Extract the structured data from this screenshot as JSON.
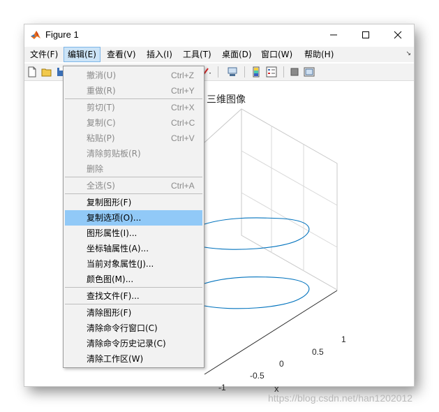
{
  "window": {
    "title": "Figure 1"
  },
  "menubar": {
    "items": [
      {
        "label": "文件(F)"
      },
      {
        "label": "编辑(E)"
      },
      {
        "label": "查看(V)"
      },
      {
        "label": "插入(I)"
      },
      {
        "label": "工具(T)"
      },
      {
        "label": "桌面(D)"
      },
      {
        "label": "窗口(W)"
      },
      {
        "label": "帮助(H)"
      }
    ]
  },
  "edit_menu": {
    "items": [
      {
        "label": "撤消(U)",
        "shortcut": "Ctrl+Z",
        "enabled": false
      },
      {
        "label": "重做(R)",
        "shortcut": "Ctrl+Y",
        "enabled": false
      },
      {
        "label": "剪切(T)",
        "shortcut": "Ctrl+X",
        "enabled": false
      },
      {
        "label": "复制(C)",
        "shortcut": "Ctrl+C",
        "enabled": false
      },
      {
        "label": "粘贴(P)",
        "shortcut": "Ctrl+V",
        "enabled": false
      },
      {
        "label": "清除剪贴板(R)",
        "shortcut": "",
        "enabled": false
      },
      {
        "label": "删除",
        "shortcut": "",
        "enabled": false
      },
      {
        "label": "全选(S)",
        "shortcut": "Ctrl+A",
        "enabled": false
      },
      {
        "label": "复制图形(F)",
        "shortcut": "",
        "enabled": true
      },
      {
        "label": "复制选项(O)...",
        "shortcut": "",
        "enabled": true,
        "highlighted": true
      },
      {
        "label": "图形属性(I)...",
        "shortcut": "",
        "enabled": true
      },
      {
        "label": "坐标轴属性(A)...",
        "shortcut": "",
        "enabled": true
      },
      {
        "label": "当前对象属性(J)...",
        "shortcut": "",
        "enabled": true
      },
      {
        "label": "颜色图(M)...",
        "shortcut": "",
        "enabled": true
      },
      {
        "label": "查找文件(F)...",
        "shortcut": "",
        "enabled": true
      },
      {
        "label": "清除图形(F)",
        "shortcut": "",
        "enabled": true
      },
      {
        "label": "清除命令行窗口(C)",
        "shortcut": "",
        "enabled": true
      },
      {
        "label": "清除命令历史记录(C)",
        "shortcut": "",
        "enabled": true
      },
      {
        "label": "清除工作区(W)",
        "shortcut": "",
        "enabled": true
      }
    ]
  },
  "plot": {
    "title": "三维图像",
    "x_label": "x",
    "x_ticks": [
      "1",
      "0.5",
      "0",
      "-0.5",
      "-1"
    ],
    "line_color": "#0072bd"
  },
  "watermark": "https://blog.csdn.net/han1202012",
  "colors": {
    "menu_highlight": "#91c9f7",
    "menubar_active": "#cce4f7",
    "chrome_bg": "#f2f2f2"
  }
}
